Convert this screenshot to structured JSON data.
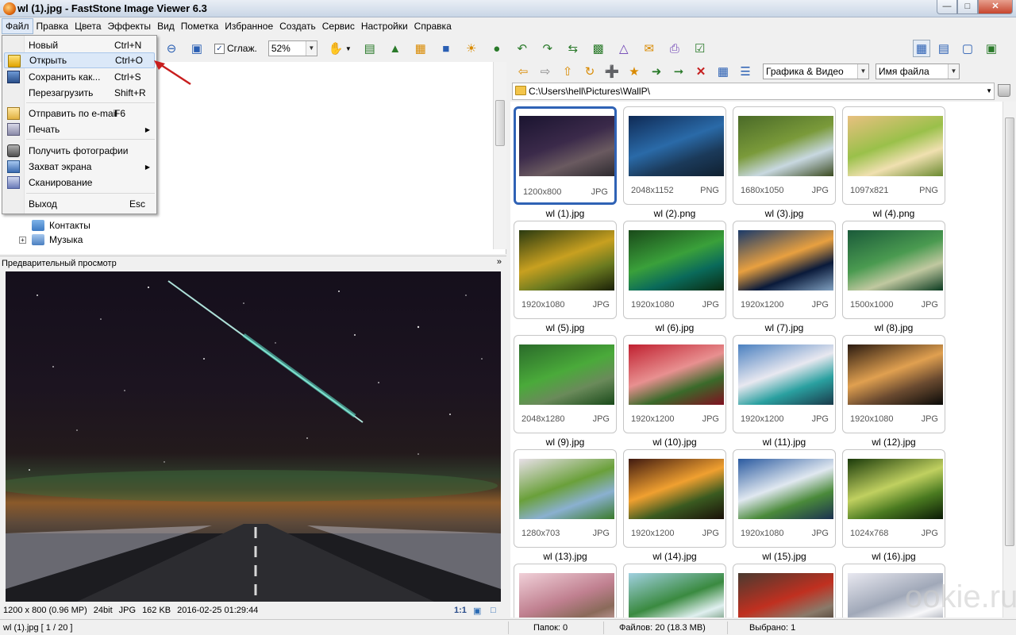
{
  "window": {
    "title": "wl (1).jpg  -  FastStone Image Viewer 6.3",
    "buttons": [
      "minimize",
      "maximize",
      "close"
    ]
  },
  "menubar": [
    "Файл",
    "Правка",
    "Цвета",
    "Эффекты",
    "Вид",
    "Пометка",
    "Избранное",
    "Создать",
    "Сервис",
    "Настройки",
    "Справка"
  ],
  "file_menu": {
    "items": [
      {
        "label": "Новый",
        "shortcut": "Ctrl+N",
        "icon": ""
      },
      {
        "label": "Открыть",
        "shortcut": "Ctrl+O",
        "icon": "open-folder-icon",
        "highlighted": true
      },
      {
        "label": "Сохранить как...",
        "shortcut": "Ctrl+S",
        "icon": "save-disk-icon"
      },
      {
        "label": "Перезагрузить",
        "shortcut": "Shift+R",
        "icon": ""
      },
      {
        "label": "Отправить по e-mail",
        "shortcut": "F6",
        "icon": "email-envelope-icon"
      },
      {
        "label": "Печать",
        "shortcut": "",
        "icon": "printer-icon",
        "submenu": true
      },
      {
        "label": "Получить фотографии",
        "shortcut": "",
        "icon": "camera-icon"
      },
      {
        "label": "Захват экрана",
        "shortcut": "",
        "icon": "screen-capture-icon",
        "submenu": true
      },
      {
        "label": "Сканирование",
        "shortcut": "",
        "icon": "scanner-icon"
      },
      {
        "label": "Выход",
        "shortcut": "Esc",
        "icon": ""
      }
    ]
  },
  "toolbar": {
    "smooth_label": "Сглаж.",
    "smooth_checked": true,
    "zoom": "52%"
  },
  "browser_toolbar": {
    "filter": "Графика & Видео",
    "sort": "Имя файла"
  },
  "path": "C:\\Users\\hell\\Pictures\\WallP\\",
  "tree": [
    {
      "label": "Контакты",
      "icon": "contacts-icon"
    },
    {
      "label": "Музыка",
      "icon": "music-icon"
    }
  ],
  "preview": {
    "header": "Предварительный просмотр",
    "status": [
      "1200 x 800 (0.96 MP)",
      "24bit",
      "JPG",
      "162 KB",
      "2016-02-25 01:29:44"
    ],
    "zoom_label": "1:1"
  },
  "thumbnails": [
    {
      "name": "wl (1).jpg",
      "dims": "1200x800",
      "fmt": "JPG",
      "selected": true,
      "colors": [
        "#1a1430",
        "#3b2a4a",
        "#6a5a60",
        "#2d2a2f"
      ]
    },
    {
      "name": "wl (2).png",
      "dims": "2048x1152",
      "fmt": "PNG",
      "colors": [
        "#0f2a55",
        "#2a6aa8",
        "#1b3a5a",
        "#102030"
      ]
    },
    {
      "name": "wl (3).jpg",
      "dims": "1680x1050",
      "fmt": "JPG",
      "colors": [
        "#4a6a28",
        "#7a9a3a",
        "#c8d8e0",
        "#3a4a20"
      ]
    },
    {
      "name": "wl (4).png",
      "dims": "1097x821",
      "fmt": "PNG",
      "colors": [
        "#e8c080",
        "#9ac04a",
        "#f0e0b0",
        "#6a8a30"
      ]
    },
    {
      "name": "wl (5).jpg",
      "dims": "1920x1080",
      "fmt": "JPG",
      "colors": [
        "#2a3a10",
        "#c8a020",
        "#6a7a20",
        "#1a2008"
      ]
    },
    {
      "name": "wl (6).jpg",
      "dims": "1920x1080",
      "fmt": "JPG",
      "colors": [
        "#1a4a1a",
        "#3aa03a",
        "#0a6a5a",
        "#0a2a10"
      ]
    },
    {
      "name": "wl (7).jpg",
      "dims": "1920x1200",
      "fmt": "JPG",
      "colors": [
        "#1a3a6a",
        "#e8a040",
        "#0a1a3a",
        "#80a0c0"
      ]
    },
    {
      "name": "wl (8).jpg",
      "dims": "1500x1000",
      "fmt": "JPG",
      "colors": [
        "#1a5a3a",
        "#4a9a50",
        "#c0c8a0",
        "#0a3a20"
      ]
    },
    {
      "name": "wl (9).jpg",
      "dims": "2048x1280",
      "fmt": "JPG",
      "colors": [
        "#2a6a2a",
        "#4aaa3a",
        "#6a8a5a",
        "#1a4a1a"
      ]
    },
    {
      "name": "wl (10).jpg",
      "dims": "1920x1200",
      "fmt": "JPG",
      "colors": [
        "#c02030",
        "#e89090",
        "#3a6a2a",
        "#801020"
      ]
    },
    {
      "name": "wl (11).jpg",
      "dims": "1920x1200",
      "fmt": "JPG",
      "colors": [
        "#4a80c0",
        "#e8e8f0",
        "#2aa0a0",
        "#1a3a4a"
      ]
    },
    {
      "name": "wl (12).jpg",
      "dims": "1920x1080",
      "fmt": "JPG",
      "colors": [
        "#2a1a10",
        "#e0a050",
        "#6a4a30",
        "#0a0a08"
      ]
    },
    {
      "name": "wl (13).jpg",
      "dims": "1280x703",
      "fmt": "JPG",
      "colors": [
        "#e8e0e8",
        "#6aa03a",
        "#8ab0d0",
        "#3a7a2a"
      ]
    },
    {
      "name": "wl (14).jpg",
      "dims": "1920x1200",
      "fmt": "JPG",
      "colors": [
        "#401a10",
        "#f0a030",
        "#3a5a20",
        "#1a1008"
      ]
    },
    {
      "name": "wl (15).jpg",
      "dims": "1920x1080",
      "fmt": "JPG",
      "colors": [
        "#2a5aa0",
        "#e0e8f0",
        "#4a8a3a",
        "#1a3050"
      ]
    },
    {
      "name": "wl (16).jpg",
      "dims": "1024x768",
      "fmt": "JPG",
      "colors": [
        "#1a3a0a",
        "#c0d060",
        "#4a7a20",
        "#0a1a05"
      ]
    },
    {
      "name": "",
      "dims": "",
      "fmt": "",
      "colors": [
        "#f0d0d8",
        "#c08090",
        "#8a6a5a",
        "#e8c0c8"
      ]
    },
    {
      "name": "",
      "dims": "",
      "fmt": "",
      "colors": [
        "#a0d0e0",
        "#3a8a40",
        "#e0f0f0",
        "#2a6030"
      ]
    },
    {
      "name": "",
      "dims": "",
      "fmt": "",
      "colors": [
        "#4a3a30",
        "#c03020",
        "#8a7a6a",
        "#2a2018"
      ]
    },
    {
      "name": "",
      "dims": "",
      "fmt": "",
      "colors": [
        "#e8e8f0",
        "#a0a8b8",
        "#f8f8fa",
        "#707888"
      ]
    }
  ],
  "statusbar": {
    "file": "wl (1).jpg [ 1 / 20 ]",
    "folders": "Папок: 0",
    "files": "Файлов: 20 (18.3 MB)",
    "selected": "Выбрано: 1"
  },
  "watermark": "ookie.ru"
}
